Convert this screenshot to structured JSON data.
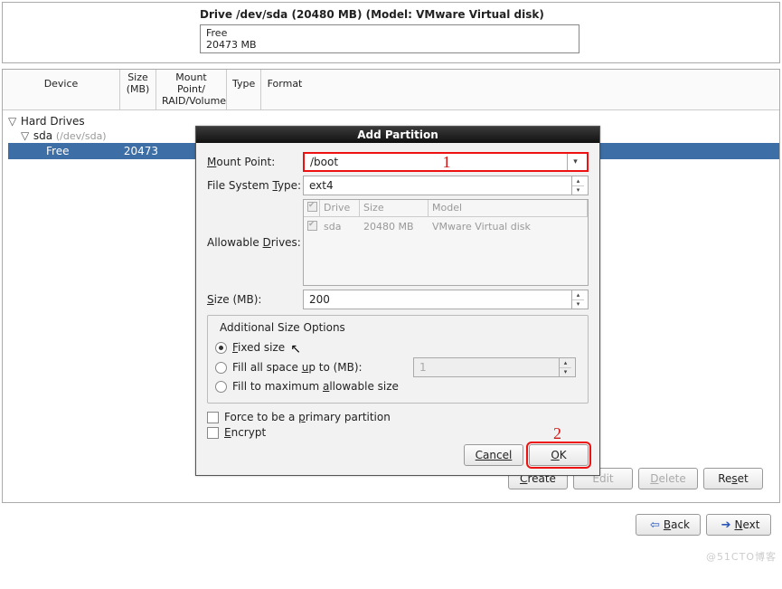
{
  "header": {
    "title": "Drive /dev/sda (20480 MB) (Model: VMware Virtual disk)",
    "free_label": "Free",
    "free_size": "20473 MB"
  },
  "table_headers": {
    "device": "Device",
    "size": "Size\n(MB)",
    "mount": "Mount Point/\nRAID/Volume",
    "type": "Type",
    "format": "Format"
  },
  "tree": {
    "root": "Hard Drives",
    "drive": "sda",
    "drive_path": "(/dev/sda)",
    "selected": {
      "label": "Free",
      "size": "20473"
    }
  },
  "dialog": {
    "title": "Add Partition",
    "mount_label_pre": "M",
    "mount_label_rest": "ount Point:",
    "mount_value": "/boot",
    "fs_label_pre": "File System ",
    "fs_label_und": "T",
    "fs_label_post": "ype:",
    "fs_value": "ext4",
    "drives_label_pre": "Allowable ",
    "drives_label_und": "D",
    "drives_label_post": "rives:",
    "drives_head": {
      "drive": "Drive",
      "size": "Size",
      "model": "Model"
    },
    "drives_row": {
      "drive": "sda",
      "size": "20480 MB",
      "model": "VMware Virtual disk"
    },
    "size_label_und": "S",
    "size_label_rest": "ize (MB):",
    "size_value": "200",
    "opts_legend": "Additional Size Options",
    "opt_fixed_und": "F",
    "opt_fixed_rest": "ixed size",
    "opt_fill_pre": "Fill all space ",
    "opt_fill_und": "u",
    "opt_fill_post": "p to (MB):",
    "opt_fill_value": "1",
    "opt_max_pre": "Fill to maximum ",
    "opt_max_und": "a",
    "opt_max_post": "llowable size",
    "force_pre": "Force to be a ",
    "force_und": "p",
    "force_post": "rimary partition",
    "encrypt_und": "E",
    "encrypt_rest": "ncrypt",
    "cancel": "Cancel",
    "ok_und": "O",
    "ok_rest": "K"
  },
  "bottom": {
    "create_und": "C",
    "create_rest": "reate",
    "edit": "Edit",
    "delete_und": "D",
    "delete_rest": "elete",
    "reset_pre": "Re",
    "reset_und": "s",
    "reset_post": "et"
  },
  "footer": {
    "back_und": "B",
    "back_rest": "ack",
    "next_und": "N",
    "next_rest": "ext"
  },
  "annotations": {
    "one": "1",
    "two": "2"
  },
  "watermark": "@51CTO博客"
}
